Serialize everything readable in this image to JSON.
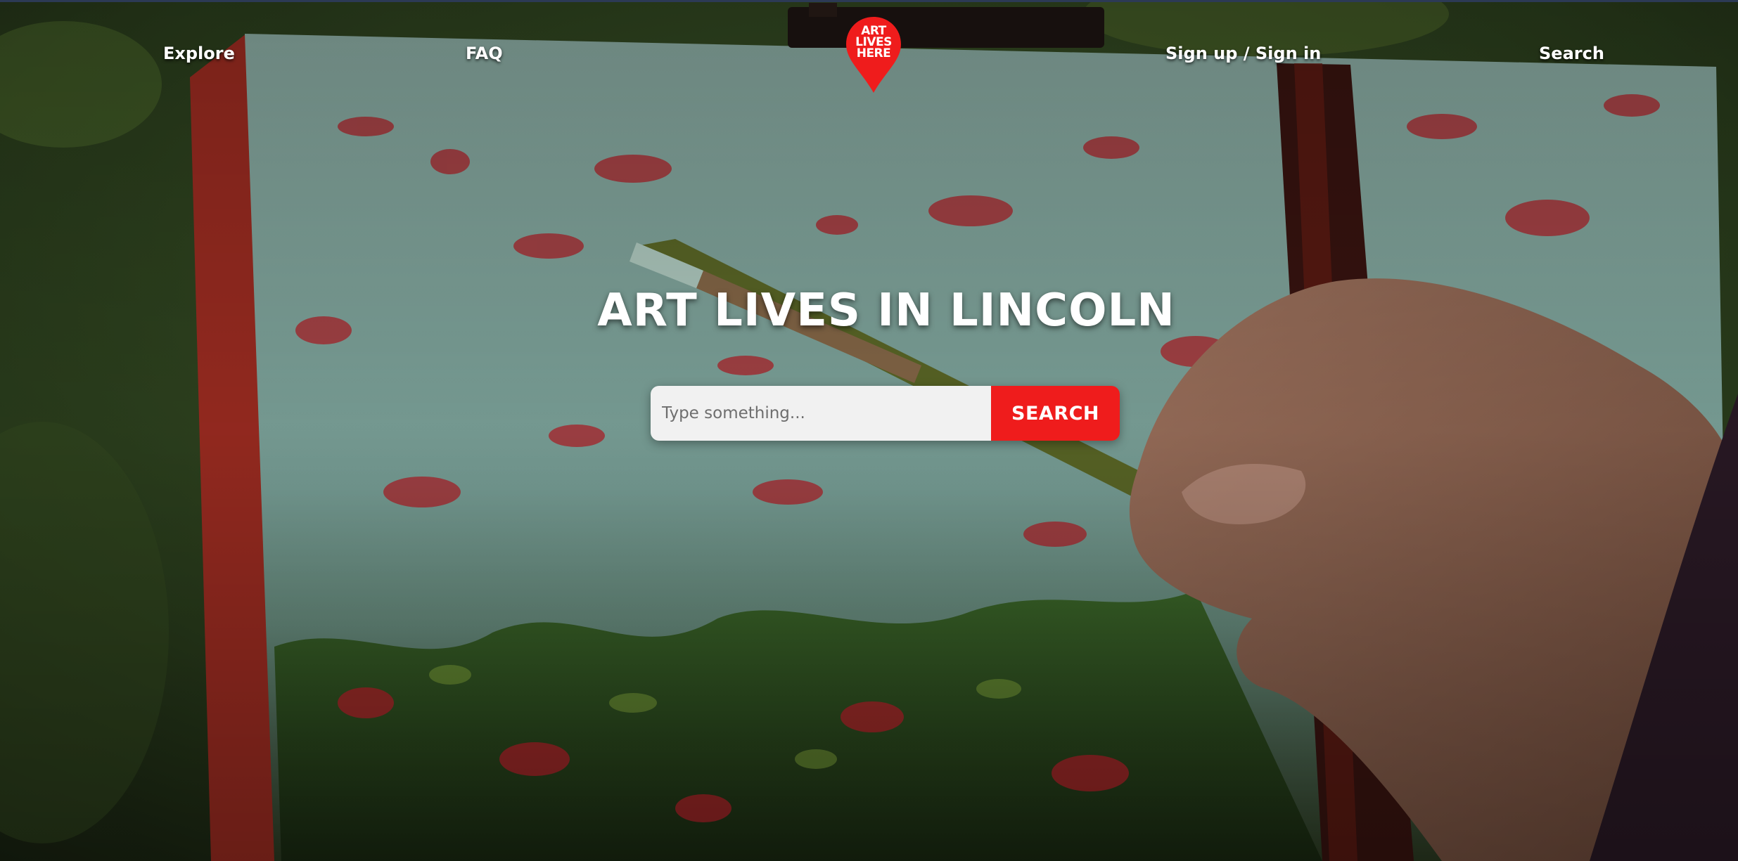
{
  "nav": {
    "explore": "Explore",
    "faq": "FAQ",
    "signin": "Sign up / Sign in",
    "search": "Search"
  },
  "logo": {
    "line1": "ART",
    "line2": "LIVES",
    "line3": "HERE",
    "color": "#ef1c1c"
  },
  "hero": {
    "title": "ART LIVES IN LINCOLN"
  },
  "search": {
    "placeholder": "Type something...",
    "button_label": "SEARCH"
  },
  "colors": {
    "accent": "#ef1c1c",
    "input_bg": "#f1f1f1",
    "text_light": "#ffffff"
  }
}
